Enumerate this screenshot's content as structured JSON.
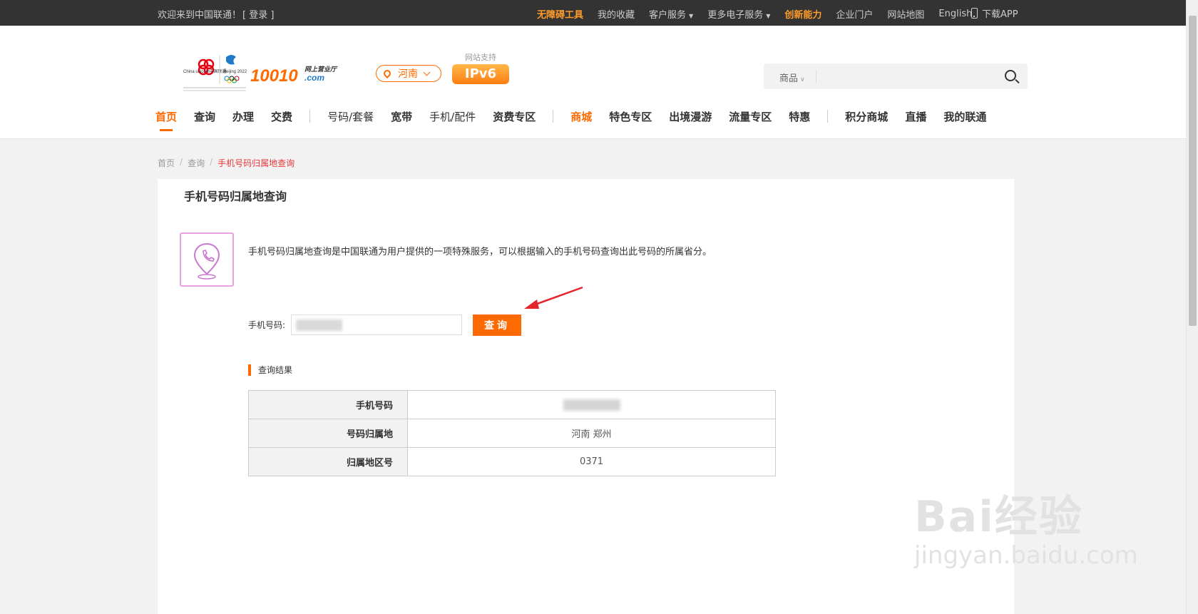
{
  "topbar": {
    "welcome": "欢迎来到中国联通！",
    "login": "[ 登录 ]",
    "links": [
      {
        "label": "无障碍工具",
        "highlight": true,
        "caret": false
      },
      {
        "label": "我的收藏",
        "highlight": false,
        "caret": false
      },
      {
        "label": "客户服务",
        "highlight": false,
        "caret": true
      },
      {
        "label": "更多电子服务",
        "highlight": false,
        "caret": true
      },
      {
        "label": "创新能力",
        "highlight": true,
        "caret": false
      },
      {
        "label": "企业门户",
        "highlight": false,
        "caret": false
      },
      {
        "label": "网站地图",
        "highlight": false,
        "caret": false
      },
      {
        "label": "English",
        "highlight": false,
        "caret": false
      }
    ],
    "download_app": "下载APP"
  },
  "header": {
    "logo": {
      "brand_en": "China unicom中国联通",
      "olympic": "Beijing 2022",
      "site": "10010",
      "site_sub": "网上营业厅",
      "site_dom": ".com"
    },
    "region": "河南",
    "ipv6_label": "网站支持",
    "ipv6_badge": "IPv6",
    "search": {
      "category": "商品",
      "placeholder": ""
    }
  },
  "nav": [
    {
      "label": "首页",
      "style": "active"
    },
    {
      "label": "查询",
      "style": "bold"
    },
    {
      "label": "办理",
      "style": "bold"
    },
    {
      "label": "交费",
      "style": "bold"
    },
    {
      "label": "|",
      "style": "divider"
    },
    {
      "label": "号码/套餐",
      "style": "normal"
    },
    {
      "label": "宽带",
      "style": "bold"
    },
    {
      "label": "手机/配件",
      "style": "normal"
    },
    {
      "label": "资费专区",
      "style": "bold"
    },
    {
      "label": "|",
      "style": "divider"
    },
    {
      "label": "商城",
      "style": "orange"
    },
    {
      "label": "特色专区",
      "style": "bold"
    },
    {
      "label": "出境漫游",
      "style": "bold"
    },
    {
      "label": "流量专区",
      "style": "bold"
    },
    {
      "label": "特惠",
      "style": "bold"
    },
    {
      "label": "|",
      "style": "divider"
    },
    {
      "label": "积分商城",
      "style": "bold"
    },
    {
      "label": "直播",
      "style": "bold"
    },
    {
      "label": "我的联通",
      "style": "bold"
    }
  ],
  "breadcrumb": {
    "home": "首页",
    "query": "查询",
    "current": "手机号码归属地查询"
  },
  "main": {
    "title": "手机号码归属地查询",
    "description": "手机号码归属地查询是中国联通为用户提供的一项特殊服务，可以根据输入的手机号码查询出此号码的所属省分。",
    "field_label": "手机号码:",
    "query_button": "查询",
    "result_heading": "查询结果",
    "results": [
      {
        "key": "手机号码",
        "value": "",
        "blurred": true
      },
      {
        "key": "号码归属地",
        "value": "河南 郑州",
        "blurred": false
      },
      {
        "key": "归属地区号",
        "value": "0371",
        "blurred": false
      }
    ]
  },
  "watermark": {
    "brand": "Bai经验",
    "url": "jingyan.baidu.com"
  },
  "colors": {
    "accent": "#ff6a00",
    "topbar_bg": "#333333",
    "icon_border": "#e9a1e4",
    "crumb_current": "#e4393c"
  }
}
